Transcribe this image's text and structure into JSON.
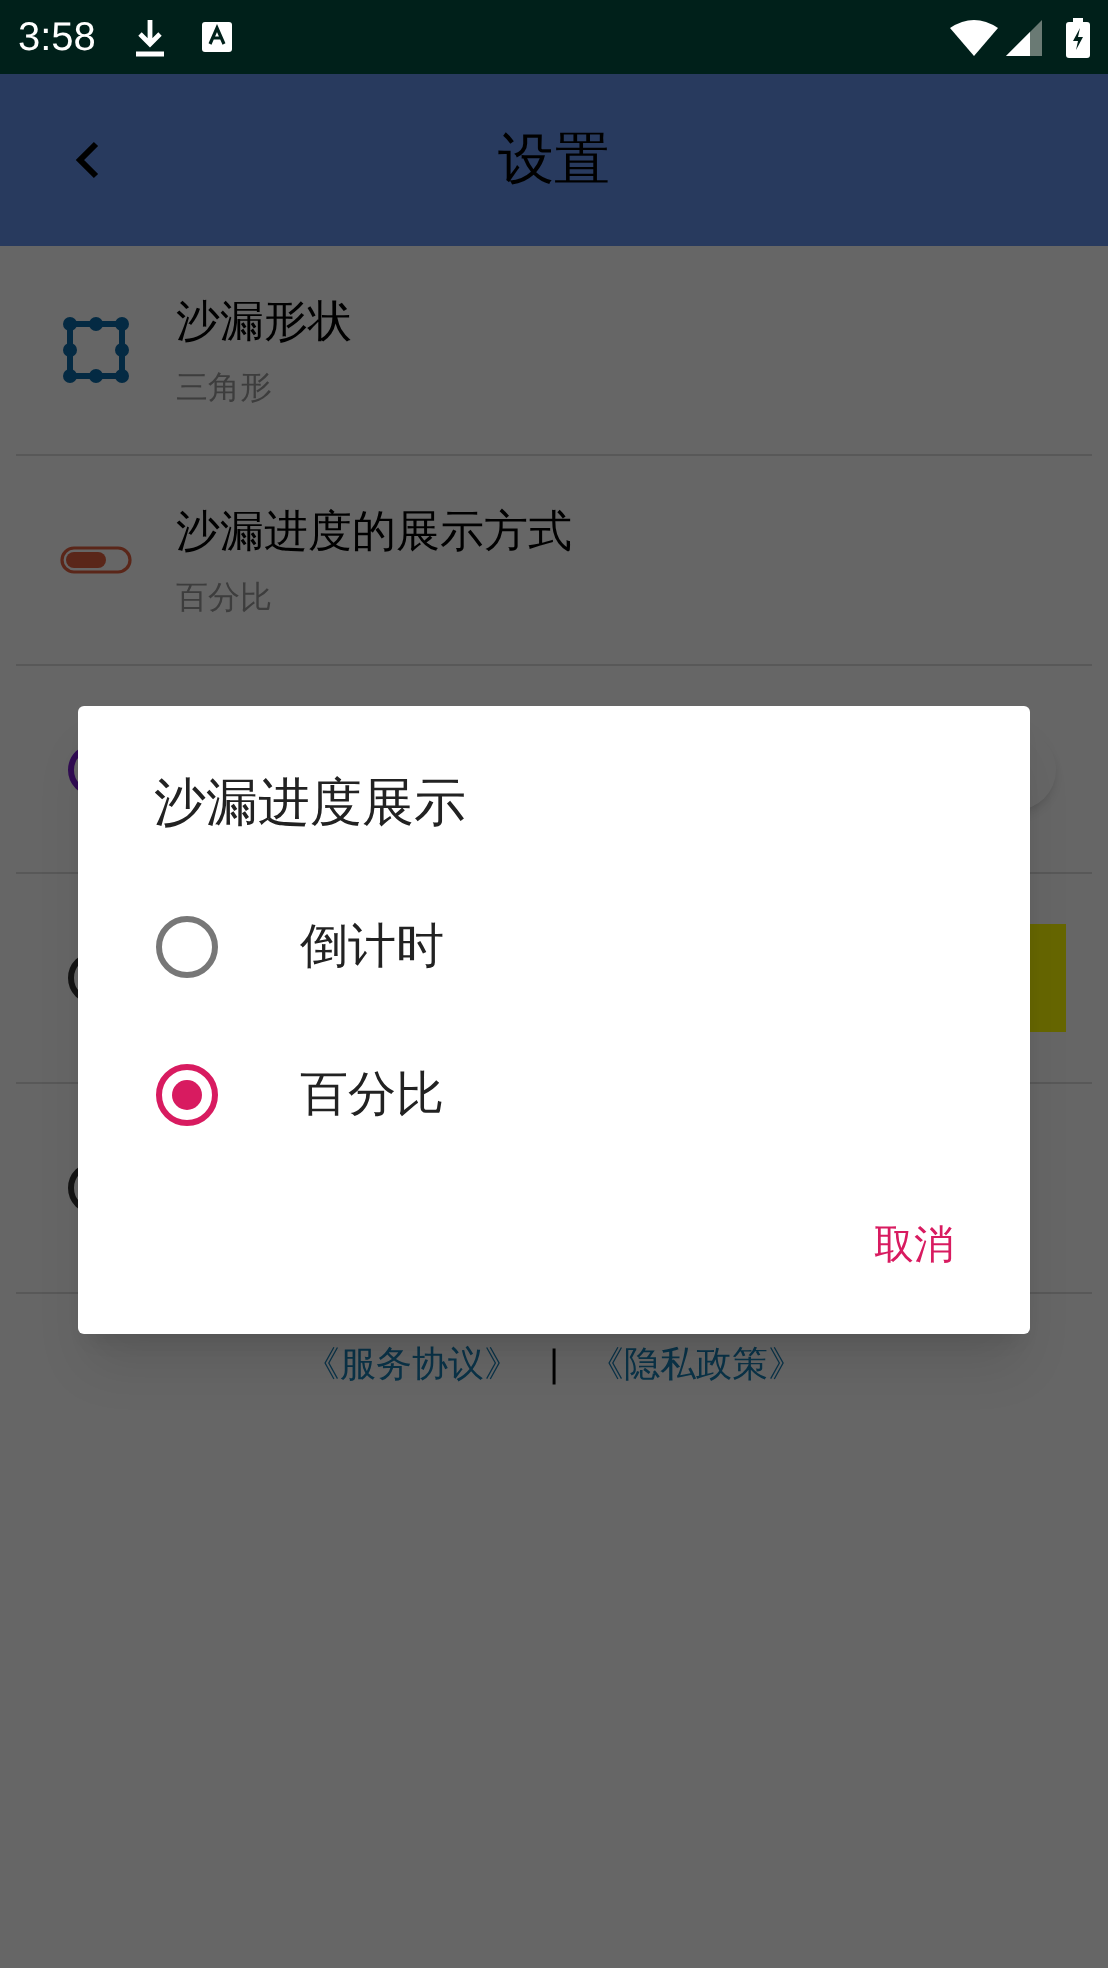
{
  "status_bar": {
    "time": "3:58"
  },
  "app_bar": {
    "title": "设置"
  },
  "settings": [
    {
      "kind": "shape",
      "title": "沙漏形状",
      "value": "三角形"
    },
    {
      "kind": "progress",
      "title": "沙漏进度的展示方式",
      "value": "百分比"
    }
  ],
  "footer": {
    "links": [
      "《服务协议》",
      "《隐私政策》"
    ],
    "separator": "|"
  },
  "dialog": {
    "title": "沙漏进度展示",
    "options": [
      {
        "label": "倒计时",
        "selected": false
      },
      {
        "label": "百分比",
        "selected": true
      }
    ],
    "cancel": "取消"
  }
}
